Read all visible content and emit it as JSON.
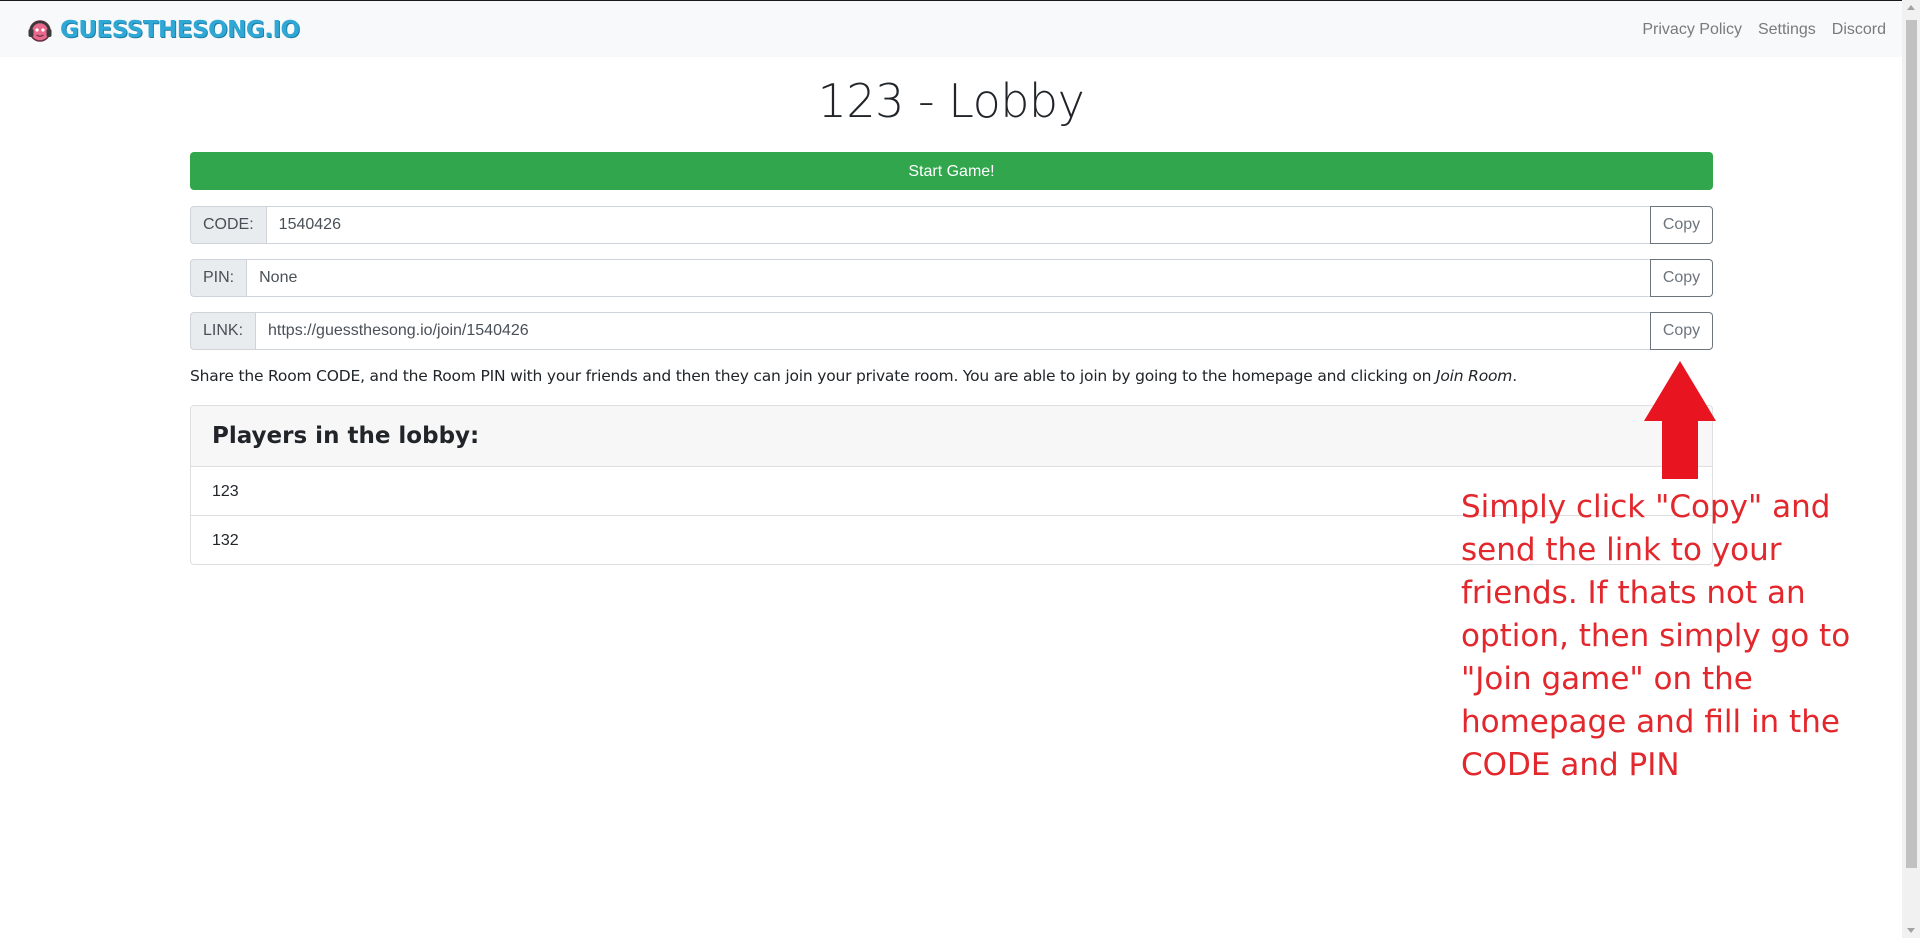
{
  "brand": {
    "name": "GUESSTHESONG.IO"
  },
  "nav": {
    "links": [
      "Privacy Policy",
      "Settings",
      "Discord"
    ]
  },
  "page": {
    "title": "123 - Lobby"
  },
  "actions": {
    "start_label": "Start Game!"
  },
  "fields": {
    "code": {
      "label": "CODE:",
      "value": "1540426",
      "copy_label": "Copy"
    },
    "pin": {
      "label": "PIN:",
      "value": "None",
      "copy_label": "Copy"
    },
    "link": {
      "label": "LINK:",
      "value": "https://guessthesong.io/join/1540426",
      "copy_label": "Copy"
    }
  },
  "share": {
    "p1": "Share the ",
    "b1": "Room CODE",
    "p2": ", and the ",
    "b2": "Room PIN",
    "p3": " with your friends and then they can join your private room. You are able to join by going to the homepage and clicking on ",
    "em": "Join Room",
    "p4": "."
  },
  "players": {
    "header": "Players in the lobby:",
    "list": [
      "123",
      "132"
    ]
  },
  "annotation": {
    "text": "Simply click \"Copy\" and send the link to your friends. If thats not an option, then simply go to \"Join game\" on the homepage and fill in the CODE and PIN",
    "color": "#e2272d"
  },
  "colors": {
    "brand": "#2fa8d6",
    "start_button": "#31a64c",
    "annotation": "#e2272d"
  }
}
